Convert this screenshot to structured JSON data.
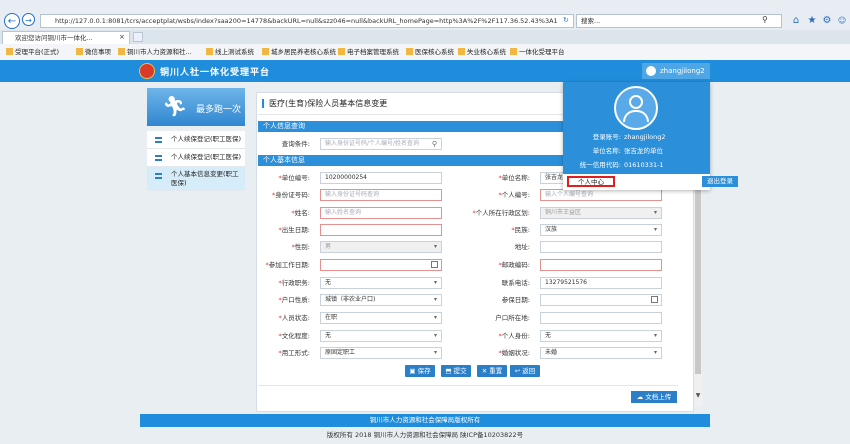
{
  "browser": {
    "address": "http://127.0.0.1:8081/tcrs/acceptplat/wsbs/index?saa200=14778&backURL=null&szz046=null&backURL_homePage=http%3A%2F%2F117.36.52.43%3A1",
    "search_placeholder": "搜索...",
    "tab_title": "欢迎您访问铜川市一体化...",
    "favorites": [
      "受理平台(正式)",
      "微信事项",
      "铜川市人力资源和社...",
      "线上测试系统",
      "城乡居民养老核心系统",
      "电子档案管理系统",
      "医保核心系统",
      "失业核心系统",
      "一体化受理平台"
    ]
  },
  "header": {
    "title": "铜川人社一体化受理平台",
    "username": "zhangjilong2"
  },
  "sidebar": {
    "banner": "最多跑一次",
    "items": [
      {
        "label": "个人续保登记(职工医保)"
      },
      {
        "label": "个人续保登记(职工医保)"
      },
      {
        "label": "个人基本信息变更(职工医保)"
      }
    ]
  },
  "main": {
    "page_title": "医疗(生育)保险人员基本信息变更",
    "query_section": "个人信息查询",
    "query_label": "查询条件:",
    "query_placeholder": "输入身份证号码/个人编号/姓名查询",
    "basic_section": "个人基本信息",
    "fields": {
      "unit_code_label": "单位编号:",
      "unit_code_value": "10200000254",
      "unit_name_label": "单位名称:",
      "unit_name_value": "张吉龙",
      "id_label": "身份证号码:",
      "id_placeholder": "输入身份证号码查询",
      "person_no_label": "个人编号:",
      "person_no_placeholder": "输入个人编号查询",
      "name_label": "姓名:",
      "name_placeholder": "输入姓名查询",
      "district_label": "个人所在行政区划:",
      "district_value": "铜川市王益区",
      "birth_label": "出生日期:",
      "ethnic_label": "民族:",
      "ethnic_value": "汉族",
      "gender_label": "性别:",
      "gender_value": "男",
      "address_label": "地址:",
      "work_date_label": "参加工作日期:",
      "postcode_label": "邮政编码:",
      "admin_post_label": "行政职务:",
      "admin_post_value": "无",
      "phone_label": "联系电话:",
      "phone_value": "13279521576",
      "hukou_label": "户口性质:",
      "hukou_value": "城镇（非农业户口)",
      "insure_date_label": "参保日期:",
      "status_label": "人员状态:",
      "status_value": "在职",
      "hukou_place_label": "户口所在地:",
      "edu_label": "文化程度:",
      "edu_value": "无",
      "identity_label": "个人身份:",
      "identity_value": "无",
      "employ_label": "用工形式:",
      "employ_value": "原固定职工",
      "marital_label": "婚姻状况:",
      "marital_value": "未婚"
    },
    "buttons": {
      "save": "保存",
      "submit": "提交",
      "reset": "重置",
      "back": "返回",
      "upload": "文档上传"
    }
  },
  "footer": {
    "line1": "铜川市人力资源和社会保障局版权所有",
    "line2": "版权所有 2018 铜川市人力资源和社会保障局 陕ICP备10203822号"
  },
  "popup": {
    "account_label": "登录账号:",
    "account_value": "zhangjilong2",
    "unit_label": "单位名称:",
    "unit_value": "张吉龙的单位",
    "credit_label": "统一信用代码:",
    "credit_value": "01610331-1",
    "personal_center": "个人中心",
    "logout": "退出登录"
  },
  "colors": {
    "primary": "#1f8ddb",
    "section": "#2b8fd9",
    "error_border": "#e69090",
    "highlight_red": "#e02020"
  }
}
